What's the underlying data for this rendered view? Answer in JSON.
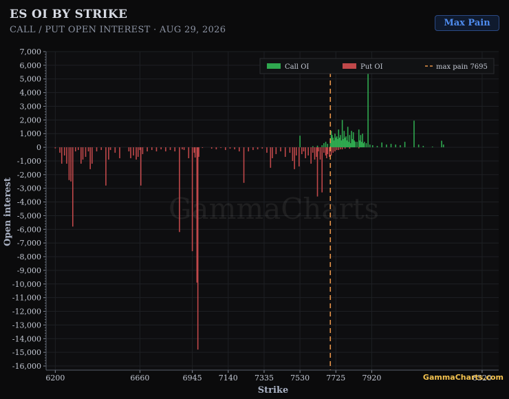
{
  "header": {
    "title": "ES OI BY STRIKE",
    "subtitle": "CALL / PUT OPEN INTEREST · AUG 29, 2026",
    "max_pain_button": "Max Pain"
  },
  "watermark": "GammaCharts",
  "corner_watermark": "GammaCharts.com",
  "colors": {
    "call": "#2fa84f",
    "put": "#c0484a",
    "max_pain": "#e8954a",
    "background": "#0b0b0c",
    "button_text": "#4f8df0"
  },
  "chart_data": {
    "type": "bar",
    "title": "ES OI BY STRIKE",
    "subtitle": "CALL / PUT OPEN INTEREST · AUG 29, 2026",
    "xlabel": "Strike",
    "ylabel": "Open interest",
    "xlim": [
      6150,
      8610
    ],
    "ylim": [
      -16300,
      7000
    ],
    "x_ticks": [
      {
        "value": 6200,
        "label": "6200"
      },
      {
        "value": 6660,
        "label": "6660"
      },
      {
        "value": 6945,
        "label": "6945"
      },
      {
        "value": 7140,
        "label": "7140"
      },
      {
        "value": 7335,
        "label": "7335"
      },
      {
        "value": 7530,
        "label": "7530"
      },
      {
        "value": 7725,
        "label": "7725"
      },
      {
        "value": 7920,
        "label": "7920"
      },
      {
        "value": 8520,
        "label": "8520"
      }
    ],
    "y_ticks": [
      7000,
      6000,
      5000,
      4000,
      3000,
      2000,
      1000,
      0,
      -1000,
      -2000,
      -3000,
      -4000,
      -5000,
      -6000,
      -7000,
      -8000,
      -9000,
      -10000,
      -11000,
      -12000,
      -13000,
      -14000,
      -15000,
      -16000
    ],
    "y_tick_labels": [
      "7,000",
      "6,000",
      "5,000",
      "4,000",
      "3,000",
      "2,000",
      "1,000",
      "0",
      "-1,000",
      "-2,000",
      "-3,000",
      "-4,000",
      "-5,000",
      "-6,000",
      "-7,000",
      "-8,000",
      "-9,000",
      "-10,000",
      "-11,000",
      "-12,000",
      "-13,000",
      "-14,000",
      "-15,000",
      "-16,000"
    ],
    "max_pain": {
      "strike": 7695,
      "label": "max pain 7695"
    },
    "legend": {
      "placement": "top-right",
      "entries": [
        "Call OI",
        "Put OI",
        "max pain 7695"
      ]
    },
    "grid": true,
    "series": [
      {
        "name": "Call OI",
        "color": "#2fa84f",
        "points": [
          [
            7530,
            850
          ],
          [
            7600,
            80
          ],
          [
            7625,
            120
          ],
          [
            7650,
            150
          ],
          [
            7660,
            300
          ],
          [
            7670,
            400
          ],
          [
            7680,
            250
          ],
          [
            7695,
            600
          ],
          [
            7700,
            1200
          ],
          [
            7705,
            900
          ],
          [
            7710,
            700
          ],
          [
            7715,
            500
          ],
          [
            7720,
            1000
          ],
          [
            7725,
            700
          ],
          [
            7730,
            800
          ],
          [
            7735,
            600
          ],
          [
            7740,
            1300
          ],
          [
            7745,
            700
          ],
          [
            7750,
            900
          ],
          [
            7755,
            500
          ],
          [
            7760,
            2000
          ],
          [
            7765,
            600
          ],
          [
            7770,
            1200
          ],
          [
            7775,
            700
          ],
          [
            7780,
            800
          ],
          [
            7785,
            500
          ],
          [
            7790,
            1500
          ],
          [
            7795,
            400
          ],
          [
            7800,
            900
          ],
          [
            7805,
            300
          ],
          [
            7810,
            1200
          ],
          [
            7815,
            600
          ],
          [
            7820,
            1100
          ],
          [
            7825,
            500
          ],
          [
            7830,
            400
          ],
          [
            7840,
            400
          ],
          [
            7850,
            1300
          ],
          [
            7855,
            500
          ],
          [
            7860,
            900
          ],
          [
            7865,
            400
          ],
          [
            7870,
            1000
          ],
          [
            7875,
            300
          ],
          [
            7880,
            400
          ],
          [
            7890,
            300
          ],
          [
            7900,
            5600
          ],
          [
            7910,
            200
          ],
          [
            7925,
            150
          ],
          [
            7950,
            100
          ],
          [
            7975,
            350
          ],
          [
            8000,
            200
          ],
          [
            8025,
            250
          ],
          [
            8050,
            200
          ],
          [
            8075,
            150
          ],
          [
            8100,
            400
          ],
          [
            8150,
            1950
          ],
          [
            8175,
            200
          ],
          [
            8200,
            100
          ],
          [
            8250,
            50
          ],
          [
            8300,
            480
          ],
          [
            8310,
            200
          ]
        ]
      },
      {
        "name": "Put OI",
        "color": "#c0484a",
        "points": [
          [
            6200,
            -80
          ],
          [
            6225,
            -400
          ],
          [
            6235,
            -1200
          ],
          [
            6250,
            -600
          ],
          [
            6262,
            -1200
          ],
          [
            6275,
            -2400
          ],
          [
            6285,
            -2500
          ],
          [
            6295,
            -5800
          ],
          [
            6310,
            -300
          ],
          [
            6325,
            -200
          ],
          [
            6340,
            -1200
          ],
          [
            6350,
            -900
          ],
          [
            6365,
            -700
          ],
          [
            6380,
            -300
          ],
          [
            6390,
            -1600
          ],
          [
            6400,
            -1200
          ],
          [
            6425,
            -300
          ],
          [
            6450,
            -200
          ],
          [
            6475,
            -2800
          ],
          [
            6490,
            -900
          ],
          [
            6500,
            -200
          ],
          [
            6525,
            -400
          ],
          [
            6550,
            -800
          ],
          [
            6600,
            -300
          ],
          [
            6610,
            -800
          ],
          [
            6625,
            -600
          ],
          [
            6640,
            -900
          ],
          [
            6650,
            -700
          ],
          [
            6660,
            -200
          ],
          [
            6665,
            -2800
          ],
          [
            6675,
            -500
          ],
          [
            6700,
            -300
          ],
          [
            6725,
            -200
          ],
          [
            6750,
            -300
          ],
          [
            6775,
            -150
          ],
          [
            6800,
            -300
          ],
          [
            6825,
            -200
          ],
          [
            6850,
            -300
          ],
          [
            6875,
            -6200
          ],
          [
            6890,
            -150
          ],
          [
            6900,
            -200
          ],
          [
            6925,
            -800
          ],
          [
            6945,
            -7600
          ],
          [
            6955,
            -400
          ],
          [
            6960,
            -750
          ],
          [
            6970,
            -9900
          ],
          [
            6975,
            -14800
          ],
          [
            6980,
            -700
          ],
          [
            7000,
            -50
          ],
          [
            7050,
            -100
          ],
          [
            7075,
            -150
          ],
          [
            7100,
            -50
          ],
          [
            7125,
            -200
          ],
          [
            7150,
            -100
          ],
          [
            7175,
            -150
          ],
          [
            7200,
            -300
          ],
          [
            7225,
            -2600
          ],
          [
            7250,
            -300
          ],
          [
            7275,
            -200
          ],
          [
            7300,
            -150
          ],
          [
            7325,
            -100
          ],
          [
            7350,
            -400
          ],
          [
            7370,
            -1500
          ],
          [
            7380,
            -800
          ],
          [
            7400,
            -500
          ],
          [
            7425,
            -300
          ],
          [
            7450,
            -700
          ],
          [
            7475,
            -400
          ],
          [
            7490,
            -1000
          ],
          [
            7500,
            -1600
          ],
          [
            7510,
            -600
          ],
          [
            7525,
            -1400
          ],
          [
            7540,
            -500
          ],
          [
            7550,
            -300
          ],
          [
            7560,
            -800
          ],
          [
            7575,
            -600
          ],
          [
            7590,
            -1200
          ],
          [
            7600,
            -400
          ],
          [
            7610,
            -900
          ],
          [
            7620,
            -700
          ],
          [
            7625,
            -3600
          ],
          [
            7630,
            -300
          ],
          [
            7640,
            -900
          ],
          [
            7650,
            -3300
          ],
          [
            7660,
            -400
          ],
          [
            7670,
            -600
          ],
          [
            7675,
            -800
          ],
          [
            7680,
            -500
          ],
          [
            7690,
            -700
          ],
          [
            7700,
            -600
          ],
          [
            7710,
            -400
          ],
          [
            7720,
            -300
          ],
          [
            7730,
            -200
          ],
          [
            7740,
            -200
          ],
          [
            7750,
            -150
          ],
          [
            7760,
            -150
          ],
          [
            7775,
            -100
          ],
          [
            7800,
            -100
          ],
          [
            7850,
            -80
          ]
        ]
      }
    ]
  }
}
